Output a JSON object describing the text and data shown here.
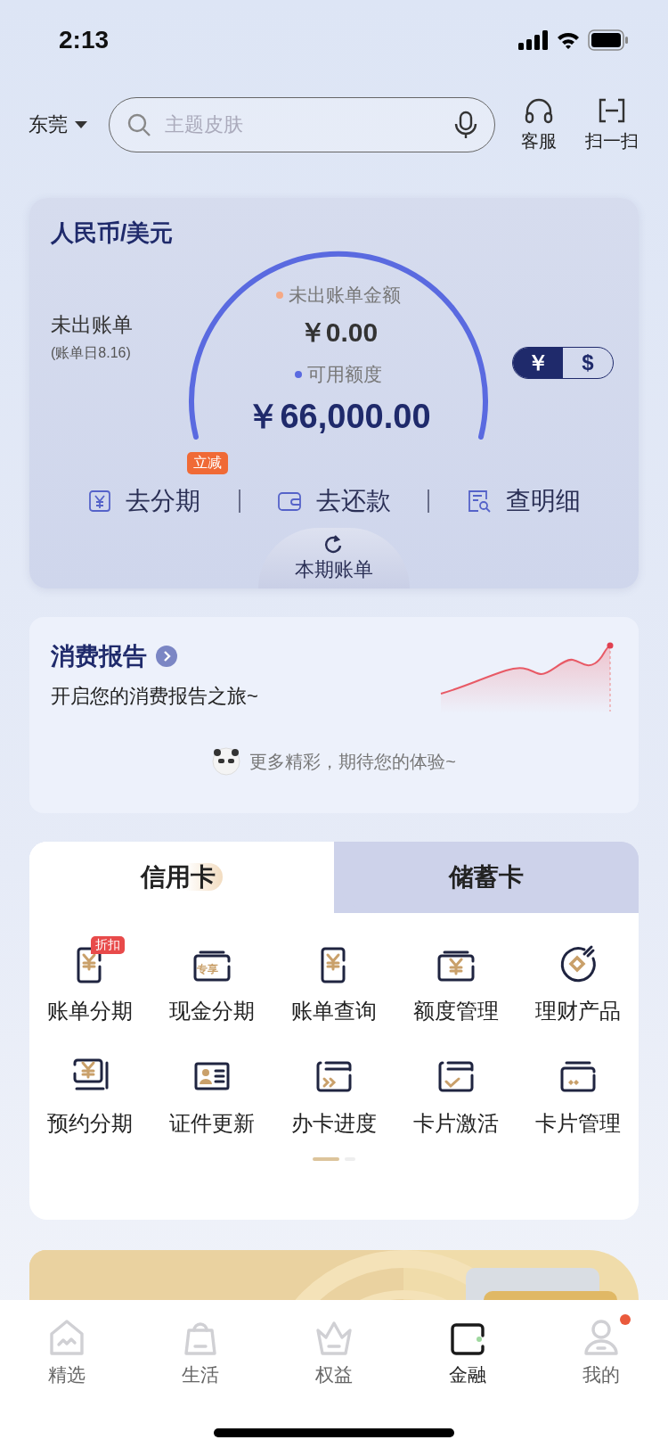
{
  "status_bar": {
    "time": "2:13"
  },
  "header": {
    "city": "东莞",
    "search": {
      "placeholder": "主题皮肤"
    },
    "actions": [
      {
        "label": "客服",
        "kind": "headset"
      },
      {
        "label": "扫一扫",
        "kind": "scan"
      }
    ]
  },
  "bill_card": {
    "title": "人民币/美元",
    "status": "未出账单",
    "bill_date": "(账单日8.16)",
    "unbilled_label": "未出账单金额",
    "unbilled_amount": "￥0.00",
    "available_label": "可用额度",
    "available_amount": "￥66,000.00",
    "currency_toggle": [
      {
        "label": "￥",
        "selected": true
      },
      {
        "label": "$",
        "selected": false
      }
    ],
    "actions": [
      {
        "label": "去分期",
        "kind": "installment",
        "badge": "立减"
      },
      {
        "label": "去还款",
        "kind": "repay"
      },
      {
        "label": "查明细",
        "kind": "detail"
      }
    ],
    "current_bill": "本期账单"
  },
  "report": {
    "title": "消费报告",
    "subtitle": "开启您的消费报告之旅~",
    "footer": "更多精彩，期待您的体验~"
  },
  "card_tabs": [
    {
      "label": "信用卡",
      "selected": true
    },
    {
      "label": "储蓄卡",
      "selected": false
    }
  ],
  "services": [
    {
      "label": "账单分期",
      "kind": "doc",
      "badge": "折扣"
    },
    {
      "label": "现金分期",
      "kind": "wallet-text",
      "icon_text": "专享"
    },
    {
      "label": "账单查询",
      "kind": "doc"
    },
    {
      "label": "额度管理",
      "kind": "wallet"
    },
    {
      "label": "理财产品",
      "kind": "coin"
    },
    {
      "label": "预约分期",
      "kind": "stack"
    },
    {
      "label": "证件更新",
      "kind": "id"
    },
    {
      "label": "办卡进度",
      "kind": "card-arrows"
    },
    {
      "label": "卡片激活",
      "kind": "card-check"
    },
    {
      "label": "卡片管理",
      "kind": "card-dots"
    }
  ],
  "pager": [
    {
      "selected": true
    },
    {
      "selected": false
    }
  ],
  "tab_bar": [
    {
      "label": "精选",
      "kind": "home",
      "selected": false,
      "notification": false
    },
    {
      "label": "生活",
      "kind": "bag",
      "selected": false,
      "notification": false
    },
    {
      "label": "权益",
      "kind": "crown",
      "selected": false,
      "notification": false
    },
    {
      "label": "金融",
      "kind": "wallet",
      "selected": true,
      "notification": false
    },
    {
      "label": "我的",
      "kind": "person",
      "selected": false,
      "notification": true
    }
  ]
}
